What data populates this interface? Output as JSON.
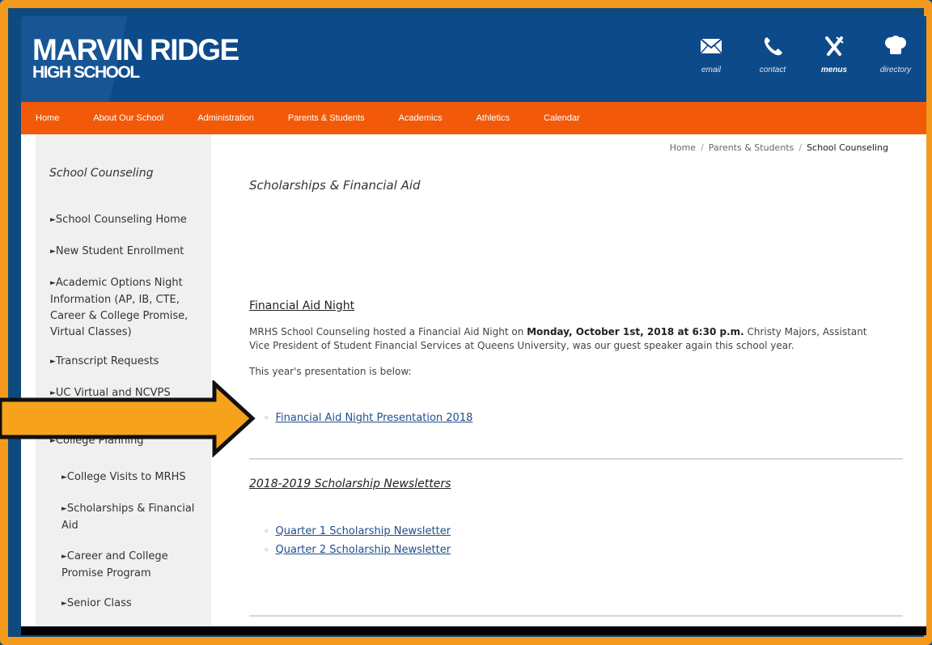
{
  "header": {
    "school_line1": "MARVIN RIDGE",
    "school_line2": "HIGH SCHOOL",
    "utility": [
      {
        "label": "email",
        "icon": "envelope-icon"
      },
      {
        "label": "contact",
        "icon": "phone-icon"
      },
      {
        "label": "menus",
        "icon": "utensils-icon"
      },
      {
        "label": "directory",
        "icon": "chef-hat-icon"
      }
    ]
  },
  "nav": [
    "Home",
    "About Our School",
    "Administration",
    "Parents & Students",
    "Academics",
    "Athletics",
    "Calendar"
  ],
  "sidebar": {
    "title": "School Counseling",
    "items": [
      "School Counseling Home",
      "New Student Enrollment",
      "Academic Options Night Information (AP, IB, CTE, Career & College Promise, Virtual Classes)",
      "Transcript Requests",
      "UC Virtual and NCVPS",
      "College Planning",
      "College Visits to MRHS",
      "Scholarships & Financial Aid",
      "Career and College Promise Program",
      "Senior Class"
    ]
  },
  "breadcrumb": [
    "Home",
    "Parents & Students",
    "School Counseling"
  ],
  "page_title": "Scholarships & Financial Aid",
  "financial_aid": {
    "heading": "Financial Aid Night",
    "p1_a": "MRHS School Counseling hosted a Financial Aid Night on ",
    "p1_b": "Monday, October 1st, 2018 at 6:30 p.m.",
    "p1_c": " Christy Majors, Assistant Vice President of Student Financial Services at Queens University, was our guest speaker again this school year.",
    "p2": "This year's presentation is below:",
    "link": "Financial Aid Night Presentation 2018"
  },
  "newsletters": {
    "heading": "2018-2019 Scholarship Newsletters",
    "links": [
      "Quarter 1 Scholarship Newsletter",
      "Quarter 2 Scholarship Newsletter"
    ]
  },
  "colors": {
    "frame": "#f39a1d",
    "header": "#0d4a8a",
    "nav": "#f25a0a",
    "arrow": "#f7a21b"
  }
}
